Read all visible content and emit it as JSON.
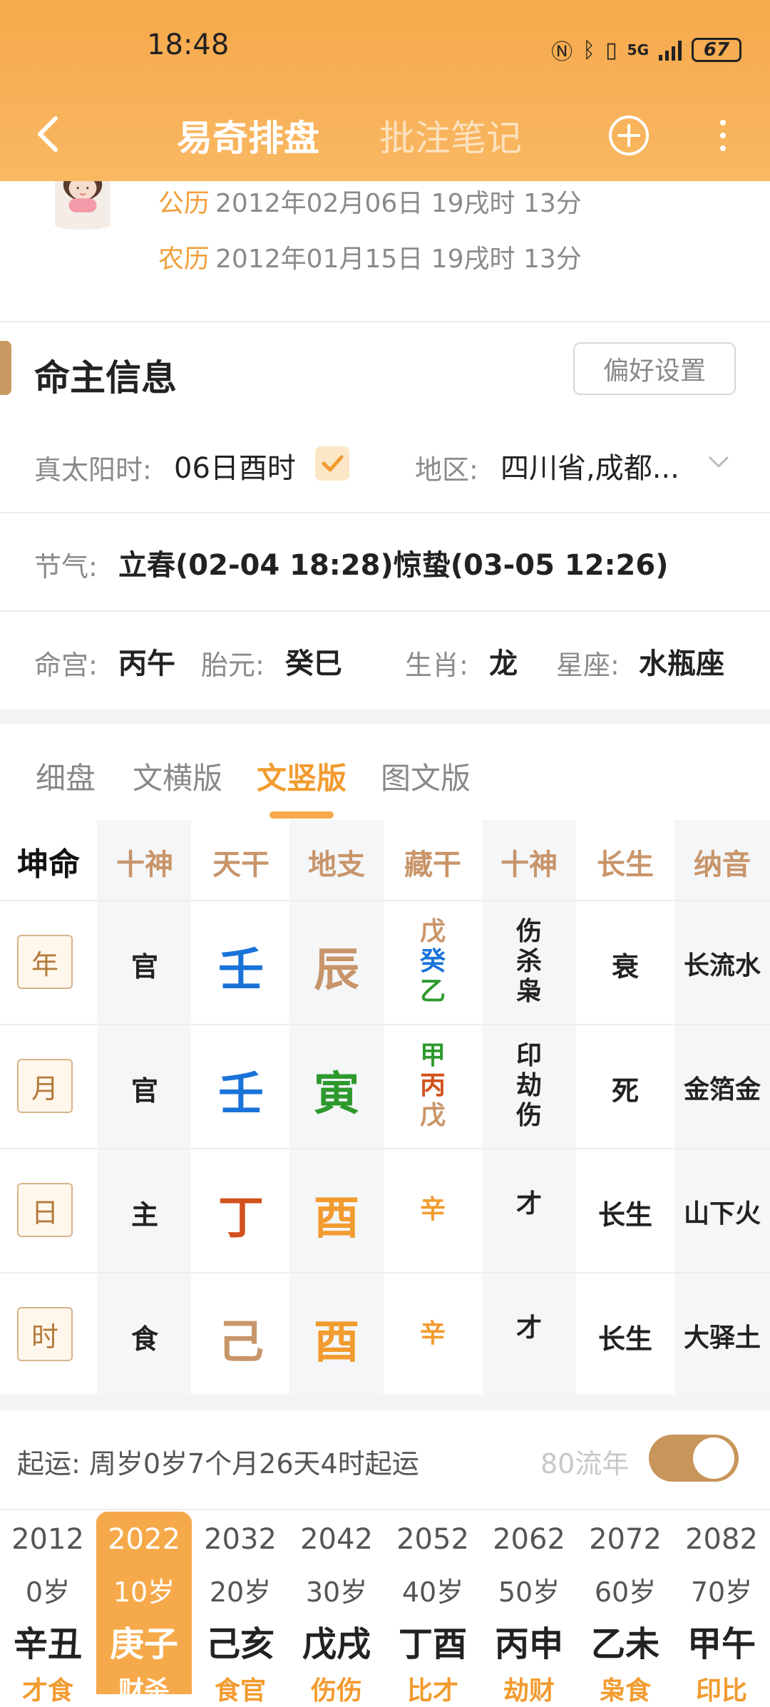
{
  "status_bar": {
    "time": "18:48",
    "network": "5G",
    "battery": "67"
  },
  "nav": {
    "tab_active": "易奇排盘",
    "tab_inactive": "批注笔记"
  },
  "profile": {
    "solar_label": "公历",
    "solar_value": "2012年02月06日 19戌时 13分",
    "lunar_label": "农历",
    "lunar_value": "2012年01月15日 19戌时 13分"
  },
  "info": {
    "title": "命主信息",
    "pref_button": "偏好设置",
    "true_solar_label": "真太阳时:",
    "true_solar_value": "06日酉时",
    "region_label": "地区:",
    "region_value": "四川省,成都...",
    "solar_term_label": "节气:",
    "solar_term_value": "立春(02-04 18:28)惊蛰(03-05 12:26)",
    "ming_gong_label": "命宫:",
    "ming_gong_value": "丙午",
    "tai_yuan_label": "胎元:",
    "tai_yuan_value": "癸巳",
    "zodiac_label": "生肖:",
    "zodiac_value": "龙",
    "constellation_label": "星座:",
    "constellation_value": "水瓶座"
  },
  "view_tabs": [
    "细盘",
    "文横版",
    "文竖版",
    "图文版"
  ],
  "table": {
    "headers": [
      "坤命",
      "十神",
      "天干",
      "地支",
      "藏干",
      "十神",
      "长生",
      "纳音"
    ],
    "rows": [
      {
        "pillar": "年",
        "shishen": "官",
        "stem": "壬",
        "stem_color": "#1a73d9",
        "branch": "辰",
        "branch_color": "#c8956a",
        "hidden": [
          {
            "c": "戊",
            "color": "#c8956a"
          },
          {
            "c": "癸",
            "color": "#1a73d9"
          },
          {
            "c": "乙",
            "color": "#2e9a2e"
          }
        ],
        "hidden_shishen": [
          "伤",
          "杀",
          "枭"
        ],
        "changsheng": "衰",
        "nayin": "长流水"
      },
      {
        "pillar": "月",
        "shishen": "官",
        "stem": "壬",
        "stem_color": "#1a73d9",
        "branch": "寅",
        "branch_color": "#2e9a2e",
        "hidden": [
          {
            "c": "甲",
            "color": "#2e9a2e"
          },
          {
            "c": "丙",
            "color": "#d2511c"
          },
          {
            "c": "戊",
            "color": "#c8956a"
          }
        ],
        "hidden_shishen": [
          "印",
          "劫",
          "伤"
        ],
        "changsheng": "死",
        "nayin": "金箔金"
      },
      {
        "pillar": "日",
        "shishen": "主",
        "stem": "丁",
        "stem_color": "#d2511c",
        "branch": "酉",
        "branch_color": "#f29b2f",
        "hidden": [
          {
            "c": "辛",
            "color": "#f29b2f"
          }
        ],
        "hidden_shishen": [
          "才"
        ],
        "changsheng": "长生",
        "nayin": "山下火"
      },
      {
        "pillar": "时",
        "shishen": "食",
        "stem": "己",
        "stem_color": "#c8956a",
        "branch": "酉",
        "branch_color": "#f29b2f",
        "hidden": [
          {
            "c": "辛",
            "color": "#f29b2f"
          }
        ],
        "hidden_shishen": [
          "才"
        ],
        "changsheng": "长生",
        "nayin": "大驿土"
      }
    ]
  },
  "luck": {
    "label": "起运:",
    "value": "周岁0岁7个月26天4时起运",
    "flow_label": "80流年",
    "decades": [
      {
        "year": "2012",
        "age": "0岁",
        "gz": "辛丑",
        "ss": "才食"
      },
      {
        "year": "2022",
        "age": "10岁",
        "gz": "庚子",
        "ss": "财杀"
      },
      {
        "year": "2032",
        "age": "20岁",
        "gz": "己亥",
        "ss": "食官"
      },
      {
        "year": "2042",
        "age": "30岁",
        "gz": "戊戌",
        "ss": "伤伤"
      },
      {
        "year": "2052",
        "age": "40岁",
        "gz": "丁酉",
        "ss": "比才"
      },
      {
        "year": "2062",
        "age": "50岁",
        "gz": "丙申",
        "ss": "劫财"
      },
      {
        "year": "2072",
        "age": "60岁",
        "gz": "乙未",
        "ss": "枭食"
      },
      {
        "year": "2082",
        "age": "70岁",
        "gz": "甲午",
        "ss": "印比"
      }
    ],
    "active_index": 1
  }
}
